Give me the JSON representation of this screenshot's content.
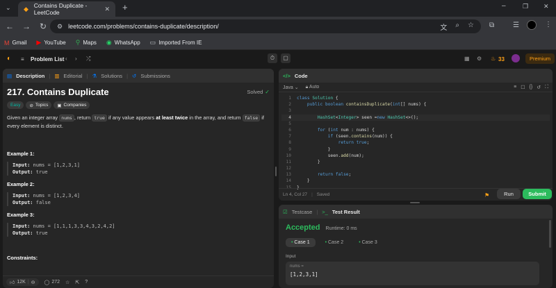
{
  "browser": {
    "tab_title": "Contains Duplicate - LeetCode",
    "url": "leetcode.com/problems/contains-duplicate/description/",
    "bookmarks": [
      {
        "label": "Gmail",
        "icon": "gmail-icon"
      },
      {
        "label": "YouTube",
        "icon": "youtube-icon"
      },
      {
        "label": "Maps",
        "icon": "maps-icon"
      },
      {
        "label": "WhatsApp",
        "icon": "whatsapp-icon"
      },
      {
        "label": "Imported From IE",
        "icon": "folder-icon"
      }
    ]
  },
  "lcnav": {
    "problem_list": "Problem List",
    "streak": "33",
    "premium": "Premium"
  },
  "left": {
    "tabs": [
      "Description",
      "Editorial",
      "Solutions",
      "Submissions"
    ],
    "title": "217. Contains Duplicate",
    "solved": "Solved",
    "tags": [
      "Easy",
      "Topics",
      "Companies"
    ],
    "desc": {
      "p1": "Given an integer array ",
      "c1": "nums",
      "p2": ", return ",
      "c2": "true",
      "p3": " if any value appears ",
      "b1": "at least twice",
      "p4": " in the array, and return ",
      "c3": "false",
      "p5": " if every element is distinct."
    },
    "examples": [
      {
        "title": "Example 1:",
        "input_label": "Input:",
        "input": "nums = [1,2,3,1]",
        "output_label": "Output:",
        "output": "true"
      },
      {
        "title": "Example 2:",
        "input_label": "Input:",
        "input": "nums = [1,2,3,4]",
        "output_label": "Output:",
        "output": "false"
      },
      {
        "title": "Example 3:",
        "input_label": "Input:",
        "input": "nums = [1,1,1,3,3,4,3,2,4,2]",
        "output_label": "Output:",
        "output": "true"
      }
    ],
    "constraints": "Constraints:",
    "footer": {
      "likes": "12K",
      "comments": "272"
    }
  },
  "code": {
    "header": "Code",
    "language": "Java",
    "mode": "Auto",
    "status": "Ln 4, Col 27",
    "saved": "Saved",
    "run": "Run",
    "submit": "Submit"
  },
  "result": {
    "tabs": [
      "Testcase",
      "Test Result"
    ],
    "accepted": "Accepted",
    "runtime": "Runtime: 0 ms",
    "cases": [
      "Case 1",
      "Case 2",
      "Case 3"
    ],
    "input_label": "Input",
    "var_label": "nums =",
    "var_value": "[1,2,3,1]"
  },
  "colors": {
    "accent": "#ffa116",
    "green": "#2cbb5d",
    "easy": "#00b8a3"
  }
}
